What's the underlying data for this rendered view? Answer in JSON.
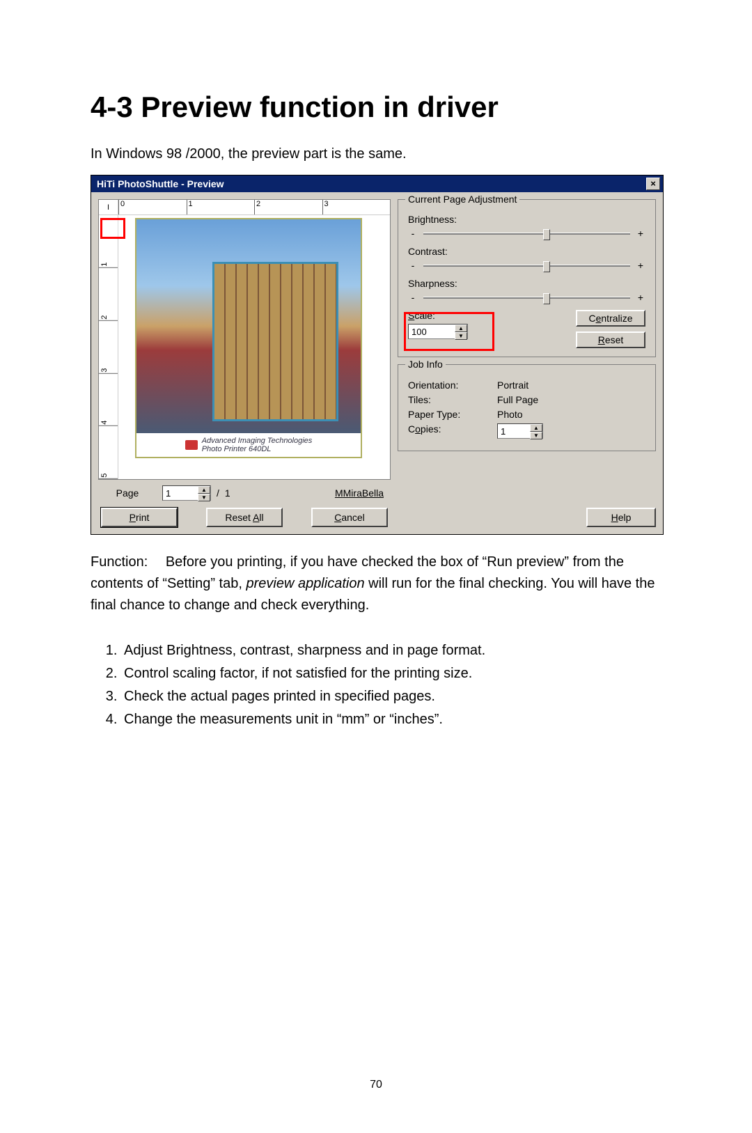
{
  "heading": "4-3  Preview function in driver",
  "intro": "In Windows 98 /2000, the preview part is the same.",
  "function_label": "Function:",
  "function_text_1": "Before you printing, if you have checked the box of “Run preview” from the contents of “Setting” tab, ",
  "function_text_em": "preview application",
  "function_text_2": " will run for the final checking.   You will have the final chance to change and check everything.",
  "list": [
    "Adjust Brightness, contrast, sharpness and in page format.",
    "Control scaling factor, if not satisfied for the printing size.",
    "Check the actual pages printed in specified pages.",
    "Change the measurements unit in “mm” or “inches”."
  ],
  "page_number": "70",
  "dialog": {
    "title": "HiTi PhotoShuttle - Preview",
    "close_glyph": "×",
    "ruler_unit": "I",
    "ruler_h": [
      "0",
      "1",
      "2",
      "3"
    ],
    "ruler_v": [
      "1",
      "2",
      "3",
      "4",
      "5"
    ],
    "photo_caption_brand": "HiTi",
    "photo_caption_line1": "Advanced Imaging Technologies",
    "photo_caption_line2": "Photo Printer 640DL",
    "page_label": "Page",
    "page_value": "1",
    "page_slash": "/",
    "page_total": "1",
    "mirabella": "MiraBella",
    "print_btn": "Print",
    "resetall_btn": "Reset All",
    "cancel_btn": "Cancel",
    "adj_legend": "Current Page Adjustment",
    "brightness": "Brightness:",
    "contrast": "Contrast:",
    "sharpness": "Sharpness:",
    "minus": "-",
    "plus": "+",
    "scale_label": "Scale:",
    "scale_value": "100",
    "centralize_btn": "Centralize",
    "reset_btn": "Reset",
    "job_legend": "Job Info",
    "orientation_k": "Orientation:",
    "orientation_v": "Portrait",
    "tiles_k": "Tiles:",
    "tiles_v": "Full Page",
    "papertype_k": "Paper Type:",
    "papertype_v": "Photo",
    "copies_k": "Copies:",
    "copies_v": "1",
    "help_btn": "Help",
    "spin_up": "▲",
    "spin_down": "▼"
  }
}
